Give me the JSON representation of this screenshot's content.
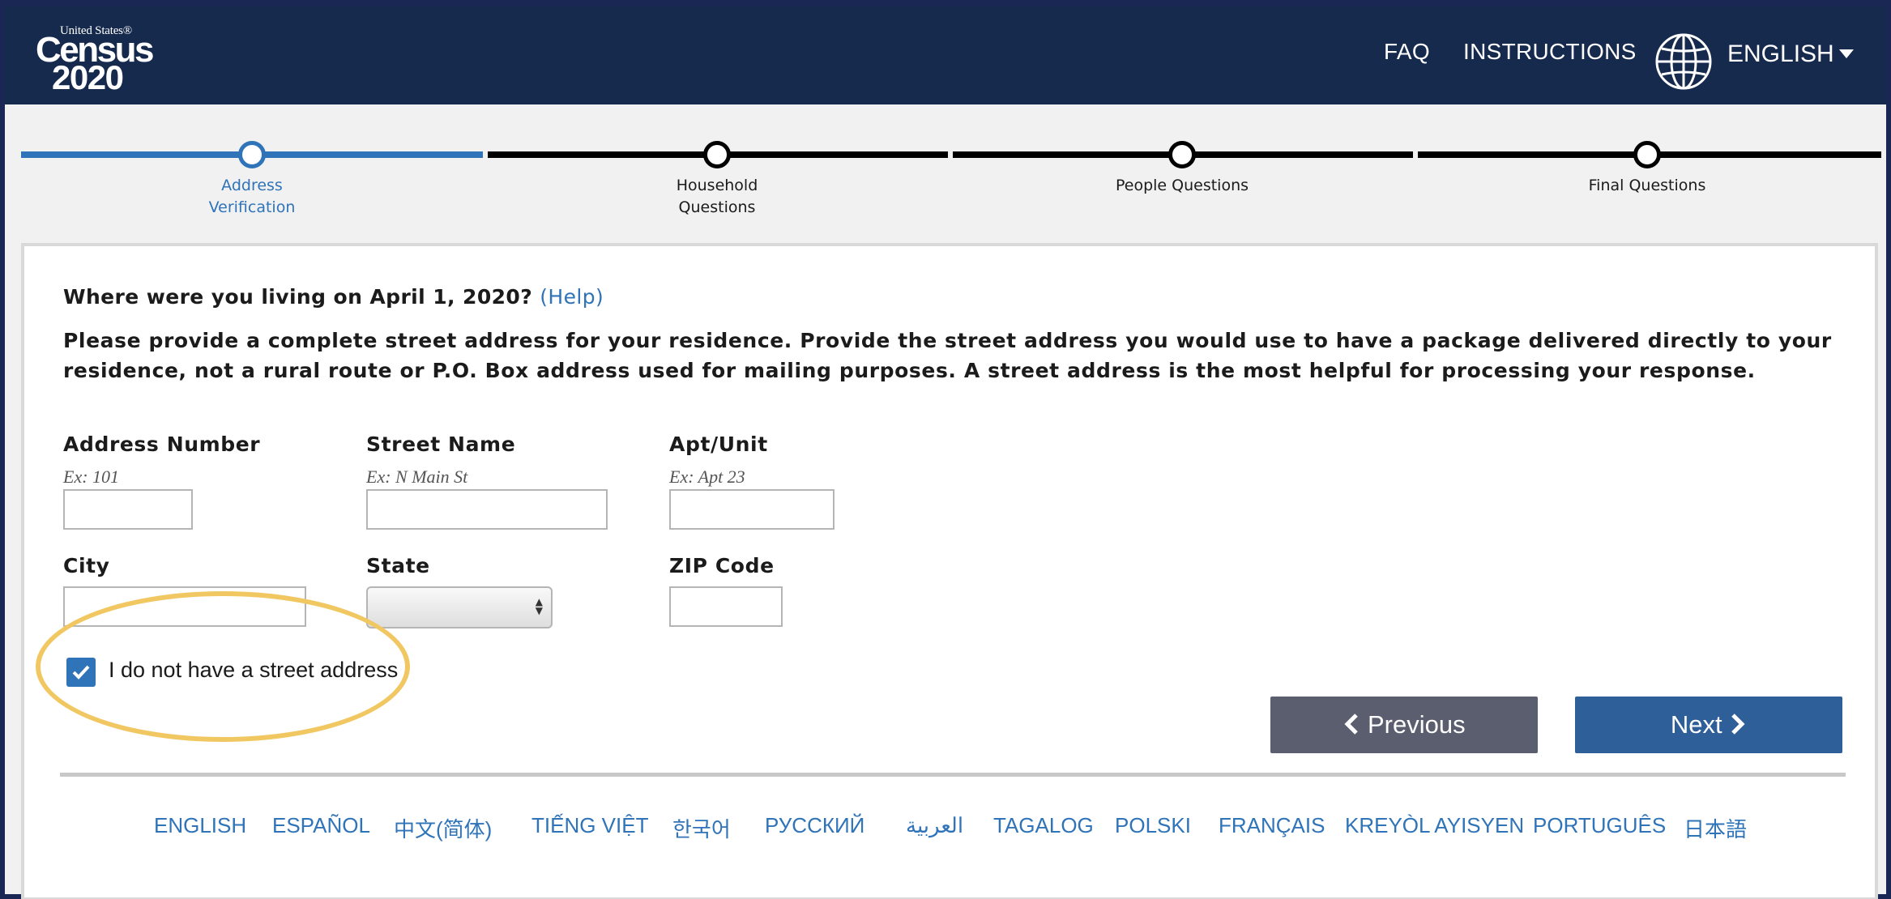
{
  "header": {
    "logo": {
      "small": "United States®",
      "census": "Census",
      "year": "2020"
    },
    "faq": "FAQ",
    "instructions": "INSTRUCTIONS",
    "language": "ENGLISH",
    "globe_icon": "globe-icon"
  },
  "progress": {
    "steps": [
      {
        "label_line1": "Address",
        "label_line2": "Verification",
        "state": "active"
      },
      {
        "label_line1": "Household",
        "label_line2": "Questions",
        "state": "incomplete"
      },
      {
        "label_line1": "People Questions",
        "label_line2": "",
        "state": "incomplete"
      },
      {
        "label_line1": "Final Questions",
        "label_line2": "",
        "state": "incomplete"
      }
    ]
  },
  "form": {
    "question": "Where were you living on April 1, 2020?",
    "help": "(Help)",
    "instructions": "Please provide a complete street address for your residence. Provide the street address you would use to have a package delivered directly to your residence, not a rural route or P.O. Box address used for mailing purposes. A street address is the most helpful for processing your response.",
    "fields": {
      "address_number": {
        "label": "Address Number",
        "example": "Ex: 101",
        "value": ""
      },
      "street_name": {
        "label": "Street Name",
        "example": "Ex: N Main St",
        "value": ""
      },
      "apt_unit": {
        "label": "Apt/Unit",
        "example": "Ex: Apt 23",
        "value": ""
      },
      "city": {
        "label": "City",
        "value": ""
      },
      "state": {
        "label": "State",
        "value": ""
      },
      "zip": {
        "label": "ZIP Code",
        "value": ""
      }
    },
    "no_street_address": {
      "label": "I do not have a street address",
      "checked": true
    }
  },
  "buttons": {
    "previous": "Previous",
    "next": "Next"
  },
  "languages": [
    "ENGLISH",
    "ESPAÑOL",
    "中文(简体)",
    "TIẾNG VIỆT",
    "한국어",
    "РУССКИЙ",
    "العربية",
    "TAGALOG",
    "POLSKI",
    "FRANÇAIS",
    "KREYÒL AYISYEN",
    "PORTUGUÊS",
    "日本語"
  ],
  "colors": {
    "header_bg": "#162a4e",
    "accent": "#2f73b8",
    "next_button": "#2e5f98",
    "previous_button": "#5b5e6e",
    "highlight": "#f1c762"
  }
}
